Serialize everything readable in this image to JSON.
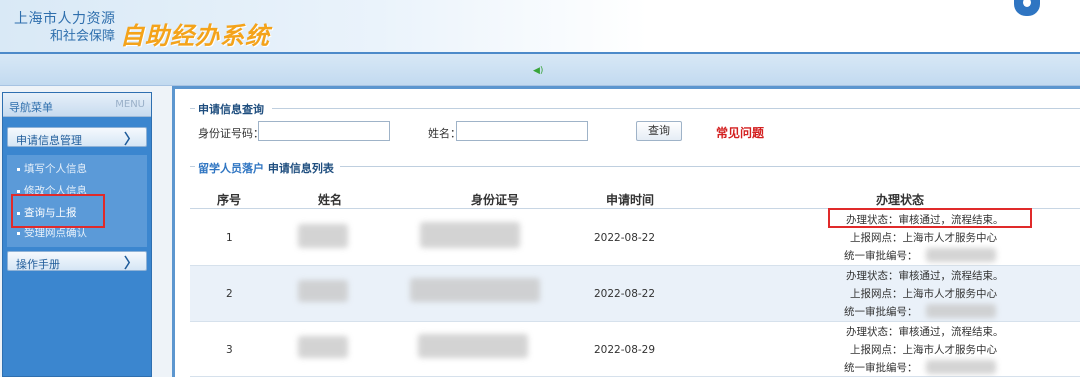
{
  "header": {
    "org_line1": "上海市人力资源",
    "org_line2": "和社会保障",
    "system_title": "自助经办系统"
  },
  "sidebar": {
    "menu_title": "导航菜单",
    "menu_title_en": "MENU",
    "groups": [
      {
        "label": "申请信息管理",
        "chevron": "〉",
        "items": [
          "填写个人信息",
          "修改个人信息",
          "查询与上报",
          "受理网点确认"
        ]
      },
      {
        "label": "操作手册",
        "chevron": "〉"
      }
    ]
  },
  "search": {
    "section_title": "申请信息查询",
    "id_label": "身份证号码：",
    "name_label": "姓名：",
    "id_value": "",
    "name_value": "",
    "query_button": "查询",
    "faq_link": "常见问题"
  },
  "list": {
    "section_prefix": "留学人员落户",
    "section_title": "申请信息列表",
    "columns": [
      "序号",
      "姓名",
      "身份证号",
      "申请时间",
      "办理状态"
    ],
    "rows": [
      {
        "seq": "1",
        "date": "2022-08-22",
        "status": "办理状态：审核通过，流程结束。",
        "station": "上报网点：上海市人才服务中心",
        "approval": "统一审批编号："
      },
      {
        "seq": "2",
        "date": "2022-08-22",
        "status": "办理状态：审核通过，流程结束。",
        "station": "上报网点：上海市人才服务中心",
        "approval": "统一审批编号："
      },
      {
        "seq": "3",
        "date": "2022-08-29",
        "status": "办理状态：审核通过，流程结束。",
        "station": "上报网点：上海市人才服务中心",
        "approval": "统一审批编号："
      }
    ]
  }
}
